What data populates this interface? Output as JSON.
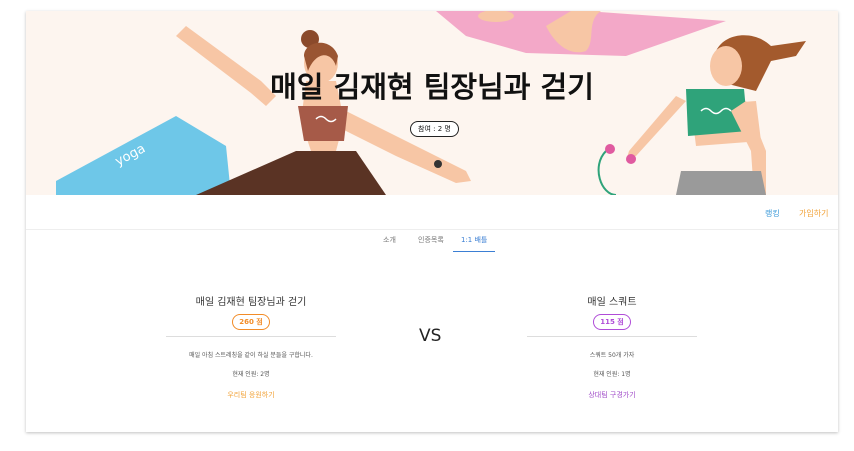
{
  "hero": {
    "title": "매일 김재현 팀장님과 걷기",
    "participants": "참여 : 2 명",
    "mat_text": "yoga"
  },
  "actions": {
    "ranking": "랭킹",
    "join": "가입하기"
  },
  "tabs": [
    {
      "label": "소개",
      "active": false
    },
    {
      "label": "인증목록",
      "active": false
    },
    {
      "label": "1:1 배틀",
      "active": true
    }
  ],
  "battle": {
    "vs": "VS",
    "left": {
      "name": "매일 김재현 팀장님과 걷기",
      "score": "260 점",
      "score_color": "#f28c28",
      "description": "매일 아침 스트레칭을 같이 하실 분들을 구합니다.",
      "members": "현재 인원: 2명",
      "link": "우리팀 응원하기",
      "link_color": "#f2a33a"
    },
    "right": {
      "name": "매일 스쿼트",
      "score": "115 점",
      "score_color": "#b04cd8",
      "description": "스쿼트 50개 가자",
      "members": "현재 인원: 1명",
      "link": "상대팀 구경가기",
      "link_color": "#a04cc8"
    }
  }
}
